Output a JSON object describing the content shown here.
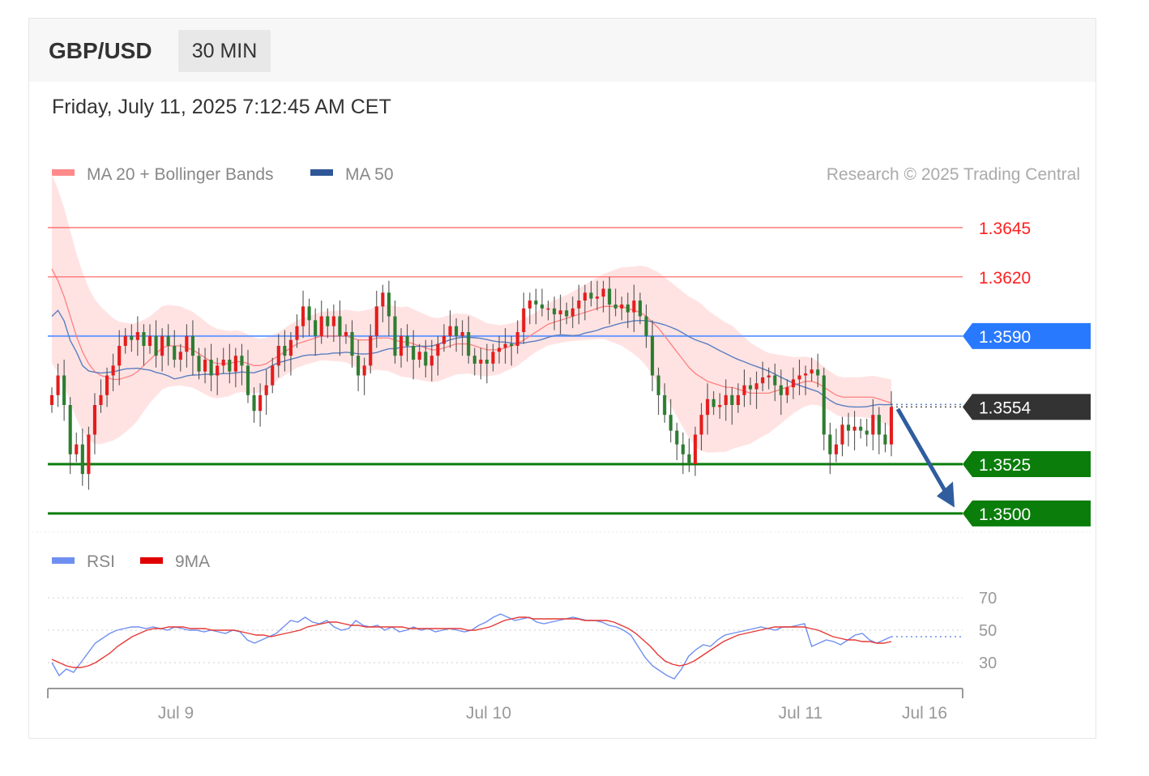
{
  "header": {
    "symbol": "GBP/USD",
    "timeframe": "30 MIN",
    "datetime": "Friday, July 11, 2025 7:12:45 AM CET"
  },
  "legend": {
    "ma20_label": "MA 20 + Bollinger Bands",
    "ma50_label": "MA 50",
    "credit": "Research © 2025 Trading Central",
    "rsi_label": "RSI",
    "rsi_ma_label": "9MA"
  },
  "colors": {
    "up": "#e41e1e",
    "down": "#2e7d32",
    "ma50": "#5a7ebf",
    "band": "#ffdede",
    "support": "#0a7d0a",
    "resistance": "#ff5d5d",
    "pivot": "#2979ff",
    "last": "#333333",
    "arrow": "#2f5d9e",
    "rsi": "#6f8ff0",
    "rsi_ma": "#e53935"
  },
  "chart_data": [
    {
      "type": "candlestick",
      "title": "GBP/USD 30 MIN",
      "x_labels": [
        "Jul 9",
        "Jul 10",
        "Jul 11",
        "Jul 16"
      ],
      "ylim": [
        1.349,
        1.366
      ],
      "levels": [
        {
          "value": 1.3645,
          "label": "1.3645",
          "kind": "resistance"
        },
        {
          "value": 1.362,
          "label": "1.3620",
          "kind": "resistance"
        },
        {
          "value": 1.359,
          "label": "1.3590",
          "kind": "pivot"
        },
        {
          "value": 1.3554,
          "label": "1.3554",
          "kind": "last"
        },
        {
          "value": 1.3525,
          "label": "1.3525",
          "kind": "support"
        },
        {
          "value": 1.35,
          "label": "1.3500",
          "kind": "support"
        }
      ],
      "close": [
        1.356,
        1.357,
        1.3555,
        1.353,
        1.3535,
        1.352,
        1.354,
        1.3555,
        1.356,
        1.357,
        1.3575,
        1.3585,
        1.359,
        1.3588,
        1.3592,
        1.3585,
        1.359,
        1.358,
        1.359,
        1.3585,
        1.3578,
        1.3582,
        1.359,
        1.358,
        1.3572,
        1.3578,
        1.357,
        1.3575,
        1.3578,
        1.3572,
        1.358,
        1.3575,
        1.356,
        1.3552,
        1.356,
        1.3565,
        1.3575,
        1.3585,
        1.358,
        1.3588,
        1.3595,
        1.3605,
        1.3598,
        1.359,
        1.36,
        1.3595,
        1.36,
        1.359,
        1.3592,
        1.358,
        1.357,
        1.3575,
        1.359,
        1.3605,
        1.3612,
        1.36,
        1.358,
        1.359,
        1.3585,
        1.3578,
        1.3582,
        1.3575,
        1.358,
        1.3586,
        1.359,
        1.3595,
        1.359,
        1.3592,
        1.358,
        1.3576,
        1.3578,
        1.3576,
        1.3582,
        1.3584,
        1.3586,
        1.3585,
        1.3592,
        1.3604,
        1.3608,
        1.3606,
        1.3604,
        1.3604,
        1.3601,
        1.3603,
        1.36,
        1.3604,
        1.3608,
        1.3612,
        1.3609,
        1.361,
        1.3614,
        1.3606,
        1.3604,
        1.3606,
        1.3602,
        1.3608,
        1.36,
        1.359,
        1.357,
        1.356,
        1.355,
        1.3542,
        1.3535,
        1.353,
        1.3525,
        1.354,
        1.355,
        1.3558,
        1.3554,
        1.3555,
        1.356,
        1.3555,
        1.356,
        1.3565,
        1.3563,
        1.3566,
        1.3569,
        1.357,
        1.3565,
        1.356,
        1.3564,
        1.3568,
        1.357,
        1.3571,
        1.3573,
        1.357,
        1.354,
        1.353,
        1.3535,
        1.3545,
        1.3542,
        1.3544,
        1.3542,
        1.354,
        1.355,
        1.354,
        1.3535,
        1.3554
      ],
      "ma20": [
        1.3624,
        1.3618,
        1.361,
        1.36,
        1.359,
        1.3582,
        1.3576,
        1.3572,
        1.357,
        1.3569,
        1.3568,
        1.3568,
        1.3569,
        1.357,
        1.3572,
        1.3575,
        1.3578,
        1.3581,
        1.3584,
        1.3585,
        1.3585,
        1.3585,
        1.3584,
        1.3583,
        1.3581,
        1.3579,
        1.3577,
        1.3576,
        1.3576,
        1.3576,
        1.3577,
        1.3577,
        1.3576,
        1.3575,
        1.3575,
        1.3576,
        1.3578,
        1.358,
        1.3582,
        1.3584,
        1.3586,
        1.3587,
        1.3588,
        1.3589,
        1.359,
        1.359,
        1.359,
        1.359,
        1.359,
        1.3589,
        1.3588,
        1.3588,
        1.3588,
        1.3589,
        1.3589,
        1.3589,
        1.3588,
        1.3587,
        1.3587,
        1.3586,
        1.3585,
        1.3584,
        1.3583,
        1.3583,
        1.3584,
        1.3585,
        1.3586,
        1.3586,
        1.3586,
        1.3585,
        1.3584,
        1.3583,
        1.3583,
        1.3583,
        1.3584,
        1.3585,
        1.3586,
        1.3588,
        1.359,
        1.3592,
        1.3594,
        1.3596,
        1.3597,
        1.3598,
        1.3599,
        1.36,
        1.3601,
        1.3602,
        1.3603,
        1.3604,
        1.3605,
        1.3605,
        1.3605,
        1.3605,
        1.3604,
        1.3603,
        1.3602,
        1.36,
        1.3597,
        1.3594,
        1.359,
        1.3586,
        1.3582,
        1.3578,
        1.3574,
        1.3571,
        1.3569,
        1.3567,
        1.3566,
        1.3565,
        1.3564,
        1.3564,
        1.3563,
        1.3562,
        1.3561,
        1.3561,
        1.3561,
        1.3561,
        1.3562,
        1.3563,
        1.3564,
        1.3565,
        1.3566,
        1.3567,
        1.3567,
        1.3566,
        1.3564,
        1.3562,
        1.356,
        1.3559,
        1.3559,
        1.3559,
        1.3559,
        1.3559,
        1.3559,
        1.3558,
        1.3557,
        1.3556
      ]
    },
    {
      "type": "line",
      "title": "RSI",
      "yticks": [
        30,
        50,
        70
      ],
      "ylim": [
        15,
        80
      ],
      "series": [
        {
          "name": "RSI",
          "values": [
            30,
            22,
            26,
            24,
            30,
            36,
            42,
            45,
            48,
            50,
            51,
            52,
            52,
            51,
            52,
            51,
            50,
            52,
            51,
            50,
            50,
            49,
            50,
            49,
            48,
            50,
            49,
            44,
            42,
            44,
            46,
            48,
            52,
            56,
            55,
            58,
            55,
            54,
            56,
            52,
            50,
            51,
            56,
            53,
            52,
            53,
            50,
            52,
            49,
            50,
            52,
            50,
            51,
            49,
            50,
            51,
            50,
            49,
            50,
            53,
            55,
            58,
            60,
            58,
            56,
            57,
            58,
            55,
            54,
            55,
            56,
            57,
            58,
            57,
            56,
            56,
            55,
            53,
            52,
            50,
            47,
            40,
            33,
            28,
            25,
            22,
            20,
            26,
            34,
            38,
            41,
            40,
            44,
            47,
            48,
            49,
            50,
            51,
            52,
            51,
            50,
            52,
            52,
            53,
            54,
            40,
            42,
            44,
            43,
            41,
            44,
            47,
            48,
            44,
            42,
            44,
            46
          ]
        },
        {
          "name": "9MA",
          "values": [
            32,
            30,
            28,
            27,
            27,
            28,
            30,
            33,
            36,
            40,
            43,
            46,
            48,
            50,
            51,
            51,
            52,
            52,
            52,
            51,
            51,
            51,
            50,
            50,
            50,
            50,
            49,
            48,
            47,
            47,
            46,
            47,
            48,
            49,
            50,
            52,
            53,
            54,
            55,
            55,
            54,
            53,
            53,
            52,
            52,
            52,
            52,
            52,
            52,
            51,
            51,
            51,
            51,
            51,
            51,
            51,
            51,
            50,
            50,
            51,
            52,
            54,
            56,
            57,
            58,
            58,
            57,
            57,
            57,
            57,
            57,
            57,
            57,
            56,
            56,
            56,
            56,
            55,
            53,
            51,
            48,
            44,
            40,
            35,
            31,
            29,
            28,
            29,
            31,
            34,
            37,
            40,
            43,
            45,
            47,
            48,
            49,
            50,
            51,
            52,
            52,
            52,
            52,
            52,
            51,
            50,
            48,
            46,
            45,
            44,
            44,
            43,
            43,
            42,
            42,
            43
          ]
        }
      ]
    }
  ]
}
